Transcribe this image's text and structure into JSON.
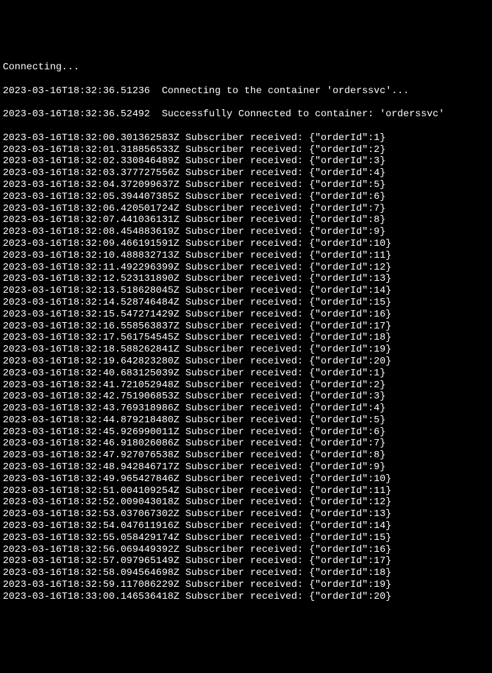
{
  "header": {
    "connecting": "Connecting...",
    "connect_line1": "2023-03-16T18:32:36.51236  Connecting to the container 'orderssvc'...",
    "connect_line2": "2023-03-16T18:32:36.52492  Successfully Connected to container: 'orderssvc'"
  },
  "logs": [
    "2023-03-16T18:32:00.301362583Z Subscriber received: {\"orderId\":1}",
    "2023-03-16T18:32:01.318856533Z Subscriber received: {\"orderId\":2}",
    "2023-03-16T18:32:02.330846489Z Subscriber received: {\"orderId\":3}",
    "2023-03-16T18:32:03.377727556Z Subscriber received: {\"orderId\":4}",
    "2023-03-16T18:32:04.372099637Z Subscriber received: {\"orderId\":5}",
    "2023-03-16T18:32:05.394407385Z Subscriber received: {\"orderId\":6}",
    "2023-03-16T18:32:06.420501724Z Subscriber received: {\"orderId\":7}",
    "2023-03-16T18:32:07.441036131Z Subscriber received: {\"orderId\":8}",
    "2023-03-16T18:32:08.454883619Z Subscriber received: {\"orderId\":9}",
    "2023-03-16T18:32:09.466191591Z Subscriber received: {\"orderId\":10}",
    "2023-03-16T18:32:10.488832713Z Subscriber received: {\"orderId\":11}",
    "2023-03-16T18:32:11.492296399Z Subscriber received: {\"orderId\":12}",
    "2023-03-16T18:32:12.523131890Z Subscriber received: {\"orderId\":13}",
    "2023-03-16T18:32:13.518628045Z Subscriber received: {\"orderId\":14}",
    "2023-03-16T18:32:14.528746484Z Subscriber received: {\"orderId\":15}",
    "2023-03-16T18:32:15.547271429Z Subscriber received: {\"orderId\":16}",
    "2023-03-16T18:32:16.558563837Z Subscriber received: {\"orderId\":17}",
    "2023-03-16T18:32:17.561754545Z Subscriber received: {\"orderId\":18}",
    "2023-03-16T18:32:18.588262841Z Subscriber received: {\"orderId\":19}",
    "2023-03-16T18:32:19.642823280Z Subscriber received: {\"orderId\":20}",
    "2023-03-16T18:32:40.683125039Z Subscriber received: {\"orderId\":1}",
    "2023-03-16T18:32:41.721052948Z Subscriber received: {\"orderId\":2}",
    "2023-03-16T18:32:42.751906853Z Subscriber received: {\"orderId\":3}",
    "2023-03-16T18:32:43.769318986Z Subscriber received: {\"orderId\":4}",
    "2023-03-16T18:32:44.879218480Z Subscriber received: {\"orderId\":5}",
    "2023-03-16T18:32:45.926990011Z Subscriber received: {\"orderId\":6}",
    "2023-03-16T18:32:46.918026086Z Subscriber received: {\"orderId\":7}",
    "2023-03-16T18:32:47.927076538Z Subscriber received: {\"orderId\":8}",
    "2023-03-16T18:32:48.942846717Z Subscriber received: {\"orderId\":9}",
    "2023-03-16T18:32:49.965427846Z Subscriber received: {\"orderId\":10}",
    "2023-03-16T18:32:51.004109254Z Subscriber received: {\"orderId\":11}",
    "2023-03-16T18:32:52.009043018Z Subscriber received: {\"orderId\":12}",
    "2023-03-16T18:32:53.037067302Z Subscriber received: {\"orderId\":13}",
    "2023-03-16T18:32:54.047611916Z Subscriber received: {\"orderId\":14}",
    "2023-03-16T18:32:55.058429174Z Subscriber received: {\"orderId\":15}",
    "2023-03-16T18:32:56.069449392Z Subscriber received: {\"orderId\":16}",
    "2023-03-16T18:32:57.097965149Z Subscriber received: {\"orderId\":17}",
    "2023-03-16T18:32:58.094564698Z Subscriber received: {\"orderId\":18}",
    "2023-03-16T18:32:59.117086229Z Subscriber received: {\"orderId\":19}",
    "2023-03-16T18:33:00.146536418Z Subscriber received: {\"orderId\":20}"
  ]
}
